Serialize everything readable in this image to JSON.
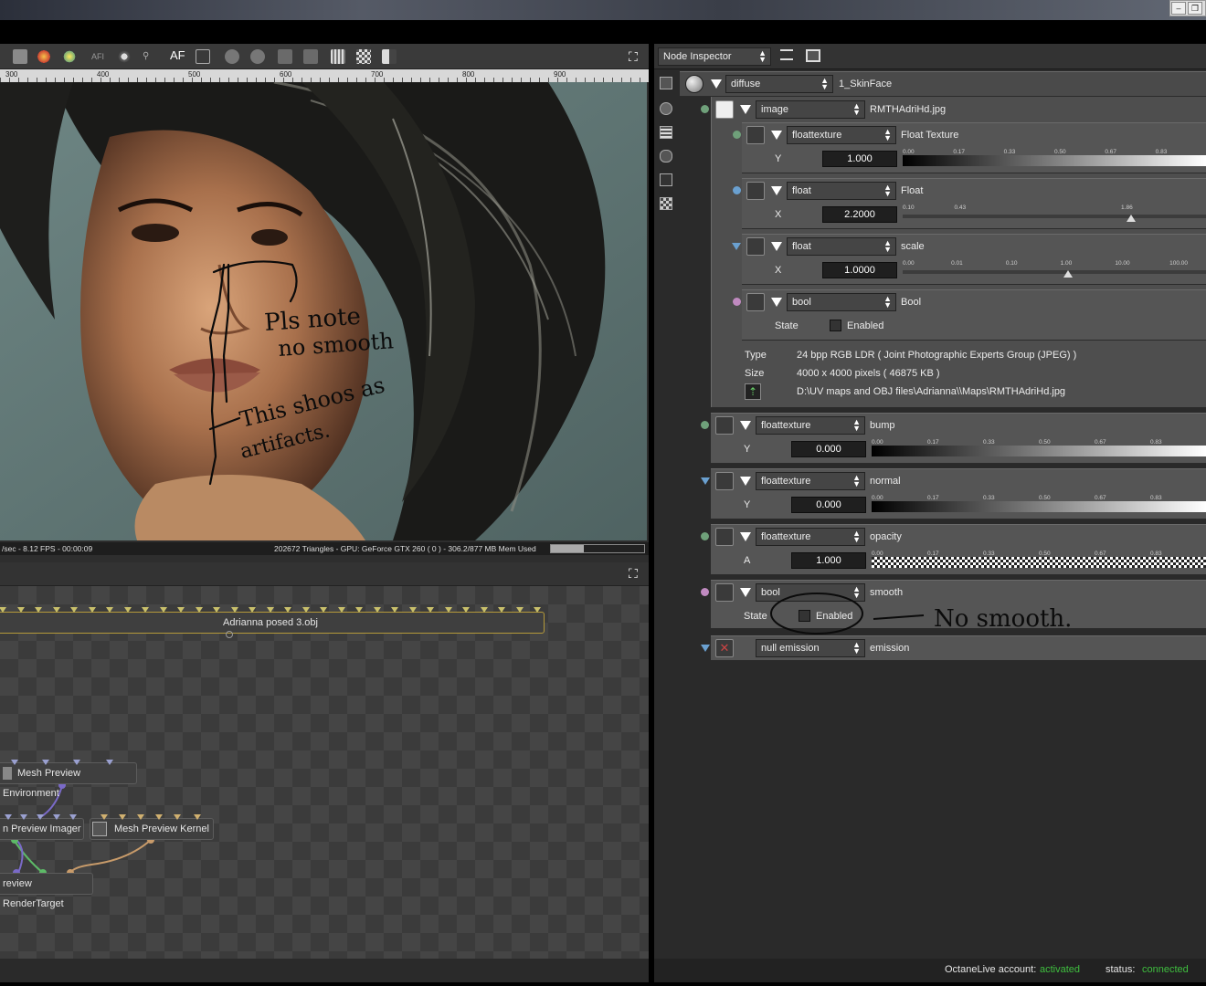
{
  "viewport": {
    "ruler_labels": [
      "300",
      "400",
      "500",
      "600",
      "700",
      "800",
      "900"
    ],
    "status_left": "/sec - 8.12 FPS - 00:00:09",
    "status_right": "202672 Triangles - GPU: GeForce GTX 260 ( 0 ) - 306.2/877 MB Mem Used",
    "mem_fraction": 0.35,
    "toolbar_af": "AF",
    "annotations": [
      "Pls note",
      "no smooth",
      "This shoos as",
      "artifacts."
    ]
  },
  "graph": {
    "mesh_node": "Adrianna posed 3.obj",
    "env_node": "Mesh Preview Environment",
    "imager_node": "n Preview Imager",
    "kernel_node": "Mesh Preview Kernel",
    "rt_node": "review RenderTarget"
  },
  "inspector": {
    "title_combo": "Node Inspector",
    "root": {
      "type": "diffuse",
      "name": "1_SkinFace"
    },
    "image": {
      "type": "image",
      "name": "RMTHAdriHd.jpg"
    },
    "float_texture": {
      "type": "floattexture",
      "name": "Float Texture",
      "param": "Y",
      "value": "1.000",
      "ticks": [
        "0.00",
        "0.17",
        "0.33",
        "0.50",
        "0.67",
        "0.83"
      ]
    },
    "float1": {
      "type": "float",
      "name": "Float",
      "param": "X",
      "value": "2.2000",
      "ticks": [
        "0.10",
        "0.43",
        "1.86"
      ]
    },
    "float2": {
      "type": "float",
      "name": "scale",
      "param": "X",
      "value": "1.0000",
      "ticks": [
        "0.00",
        "0.01",
        "0.10",
        "1.00",
        "10.00",
        "100.00"
      ]
    },
    "bool1": {
      "type": "bool",
      "name": "Bool",
      "param": "State",
      "check_label": "Enabled"
    },
    "file_info": {
      "type_label": "Type",
      "type_value": "24 bpp RGB LDR ( Joint Photographic Experts Group (JPEG) )",
      "size_label": "Size",
      "size_value": "4000 x 4000 pixels ( 46875 KB )",
      "path": "D:\\UV maps and OBJ files\\Adrianna\\\\Maps\\RMTHAdriHd.jpg"
    },
    "bump": {
      "type": "floattexture",
      "name": "bump",
      "param": "Y",
      "value": "0.000",
      "ticks": [
        "0.00",
        "0.17",
        "0.33",
        "0.50",
        "0.67",
        "0.83"
      ]
    },
    "normal": {
      "type": "floattexture",
      "name": "normal",
      "param": "Y",
      "value": "0.000",
      "ticks": [
        "0.00",
        "0.17",
        "0.33",
        "0.50",
        "0.67",
        "0.83"
      ]
    },
    "opacity": {
      "type": "floattexture",
      "name": "opacity",
      "param": "A",
      "value": "1.000",
      "ticks": [
        "0.00",
        "0.17",
        "0.33",
        "0.50",
        "0.67",
        "0.83"
      ]
    },
    "smooth": {
      "type": "bool",
      "name": "smooth",
      "param": "State",
      "check_label": "Enabled",
      "note": "No smooth."
    },
    "emission": {
      "type": "null emission",
      "name": "emission"
    }
  },
  "footer": {
    "account_label": "OctaneLive account:",
    "account_value": "activated",
    "status_label": "status:",
    "status_value": "connected",
    "accent_color": "#3fbf3f"
  }
}
